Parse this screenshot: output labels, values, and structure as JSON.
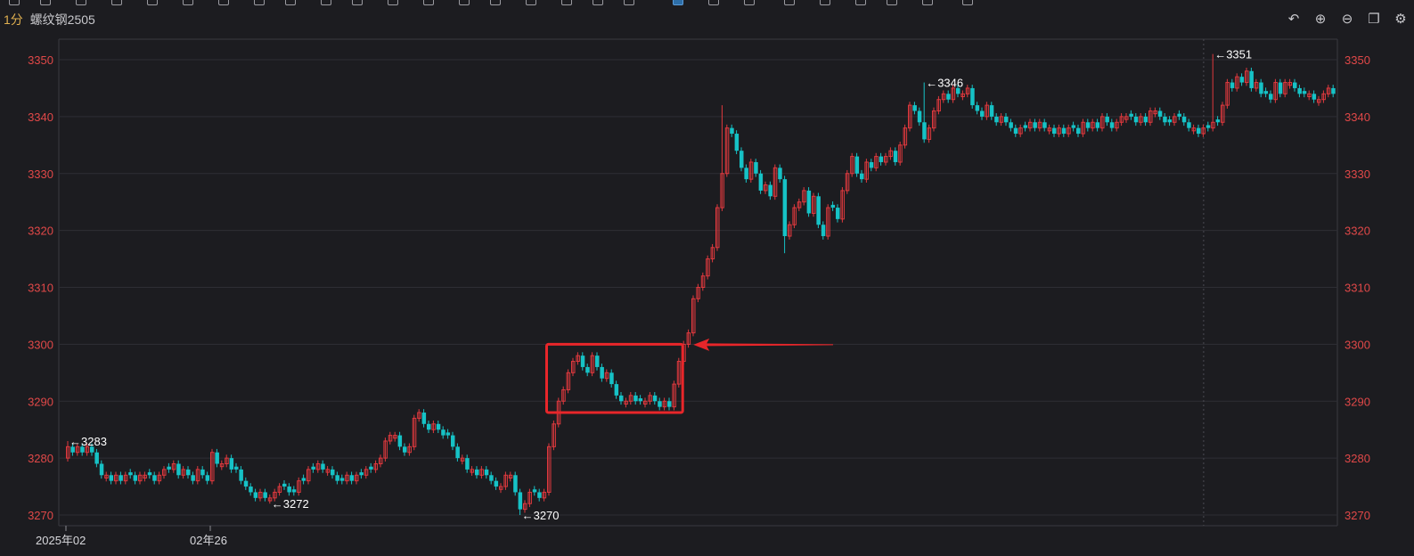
{
  "header": {
    "period": "1分",
    "symbol": "螺纹钢2505"
  },
  "controls": [
    {
      "name": "undo-icon",
      "glyph": "↶"
    },
    {
      "name": "zoom-in-icon",
      "glyph": "⊕"
    },
    {
      "name": "zoom-out-icon",
      "glyph": "⊖"
    },
    {
      "name": "window-icon",
      "glyph": "❐"
    },
    {
      "name": "settings-icon",
      "glyph": "⚙"
    }
  ],
  "colors": {
    "up": "#e0393e",
    "down": "#16c2c6",
    "grid": "#2e2e34",
    "axis_text": "#e04848",
    "highlight": "#e8262a"
  },
  "chart_data": {
    "type": "candlestick",
    "ylim": [
      3268,
      3354
    ],
    "yticks": [
      3270,
      3280,
      3290,
      3300,
      3310,
      3320,
      3330,
      3340,
      3350
    ],
    "x_tick_labels": [
      {
        "index": 0,
        "label": "2025年02"
      },
      {
        "index": 30,
        "label": "02年26"
      }
    ],
    "annotations": [
      {
        "index": 0,
        "price": 3283,
        "text": "←3283"
      },
      {
        "index": 42,
        "price": 3272,
        "text": "←3272"
      },
      {
        "index": 94,
        "price": 3270,
        "text": "←3270"
      },
      {
        "index": 178,
        "price": 3346,
        "text": "←3346"
      },
      {
        "index": 238,
        "price": 3351,
        "text": "←3351"
      }
    ],
    "session_break_index": 236,
    "highlight": {
      "from_index": 100,
      "to_index": 128,
      "low": 3288,
      "high": 3300
    },
    "close": [
      3282,
      3281,
      3282,
      3281,
      3282,
      3281,
      3279,
      3277,
      3277,
      3276,
      3277,
      3276,
      3277,
      3277,
      3276,
      3277,
      3277,
      3277,
      3276,
      3277,
      3278,
      3278,
      3279,
      3277,
      3278,
      3277,
      3276,
      3278,
      3277,
      3276,
      3281,
      3279,
      3279,
      3280,
      3278,
      3278,
      3276,
      3275,
      3274,
      3273,
      3274,
      3273,
      3273,
      3274,
      3275,
      3275,
      3274,
      3274,
      3276,
      3276,
      3278,
      3278,
      3279,
      3278,
      3278,
      3277,
      3276,
      3276,
      3277,
      3276,
      3277,
      3277,
      3278,
      3278,
      3279,
      3280,
      3283,
      3284,
      3284,
      3282,
      3281,
      3282,
      3287,
      3288,
      3286,
      3285,
      3286,
      3285,
      3284,
      3284,
      3282,
      3280,
      3280,
      3278,
      3278,
      3277,
      3278,
      3277,
      3276,
      3275,
      3275,
      3277,
      3277,
      3274,
      3271,
      3272,
      3274,
      3274,
      3273,
      3274,
      3282,
      3286,
      3290,
      3292,
      3295,
      3297,
      3298,
      3296,
      3295,
      3298,
      3296,
      3294,
      3295,
      3293,
      3291,
      3290,
      3290,
      3291,
      3290,
      3290,
      3290,
      3291,
      3290,
      3289,
      3290,
      3289,
      3293,
      3297,
      3300,
      3302,
      3308,
      3310,
      3312,
      3315,
      3317,
      3324,
      3330,
      3338,
      3337,
      3334,
      3331,
      3329,
      3332,
      3330,
      3327,
      3328,
      3326,
      3331,
      3329,
      3319,
      3321,
      3324,
      3325,
      3327,
      3323,
      3326,
      3321,
      3319,
      3324,
      3324,
      3322,
      3327,
      3330,
      3333,
      3330,
      3329,
      3332,
      3331,
      3333,
      3332,
      3333,
      3334,
      3332,
      3335,
      3338,
      3342,
      3341,
      3339,
      3336,
      3338,
      3341,
      3343,
      3344,
      3343,
      3345,
      3344,
      3344,
      3345,
      3342,
      3341,
      3340,
      3342,
      3340,
      3339,
      3340,
      3339,
      3338,
      3337,
      3338,
      3338,
      3339,
      3338,
      3339,
      3338,
      3338,
      3337,
      3338,
      3337,
      3338,
      3338,
      3337,
      3339,
      3338,
      3339,
      3338,
      3340,
      3339,
      3338,
      3339,
      3340,
      3340,
      3340,
      3339,
      3340,
      3339,
      3341,
      3341,
      3340,
      3339,
      3339,
      3340,
      3340,
      3339,
      3338,
      3338,
      3337,
      3338,
      3338,
      3339,
      3339,
      3342,
      3346,
      3345,
      3347,
      3346,
      3348,
      3345,
      3346,
      3344,
      3344,
      3343,
      3346,
      3344,
      3346,
      3346,
      3345,
      3344,
      3344,
      3344,
      3343,
      3343,
      3344,
      3345,
      3344
    ]
  }
}
